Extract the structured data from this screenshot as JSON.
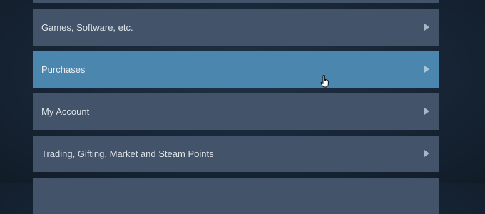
{
  "menu": {
    "items": [
      {
        "label": ""
      },
      {
        "label": "Games, Software, etc."
      },
      {
        "label": "Purchases"
      },
      {
        "label": "My Account"
      },
      {
        "label": "Trading, Gifting, Market and Steam Points"
      },
      {
        "label": ""
      }
    ],
    "active_item": "Purchases"
  },
  "icons": {
    "chevron": "chevron-right-icon",
    "cursor": "hand-pointer-cursor-icon"
  },
  "colors": {
    "page_background": "#172536",
    "item_background": "#42536a",
    "item_active_background": "#4a86ae",
    "item_text": "#dfe3e8",
    "arrow": "#a9b6c4"
  }
}
